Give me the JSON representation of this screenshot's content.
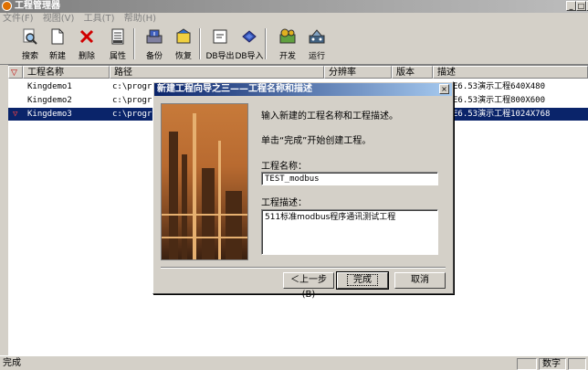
{
  "window": {
    "title": "工程管理器",
    "menu": [
      "文件(F)",
      "视图(V)",
      "工具(T)",
      "帮助(H)"
    ]
  },
  "toolbar": {
    "items": [
      {
        "label": "搜索",
        "icon": "search-icon"
      },
      {
        "label": "新建",
        "icon": "new-document-icon"
      },
      {
        "label": "删除",
        "icon": "delete-x-icon"
      },
      {
        "label": "属性",
        "icon": "properties-icon"
      },
      {
        "label": "备份",
        "icon": "backup-icon"
      },
      {
        "label": "恢复",
        "icon": "restore-icon"
      },
      {
        "label": "DB导出",
        "icon": "db-export-icon"
      },
      {
        "label": "DB导入",
        "icon": "db-import-icon"
      },
      {
        "label": "开发",
        "icon": "develop-icon"
      },
      {
        "label": "运行",
        "icon": "run-icon"
      }
    ]
  },
  "list": {
    "headers": {
      "name": "工程名称",
      "path": "路径",
      "resolution": "分辨率",
      "version": "版本",
      "desc": "描述"
    },
    "rows": [
      {
        "name": "Kingdemo1",
        "path": "c:\\program",
        "desc": "E6.53演示工程640X480",
        "selected": false
      },
      {
        "name": "Kingdemo2",
        "path": "c:\\program",
        "desc": "E6.53演示工程800X600",
        "selected": false
      },
      {
        "name": "Kingdemo3",
        "path": "c:\\program",
        "desc": "E6.53演示工程1024X768",
        "selected": true
      }
    ]
  },
  "status": {
    "text": "完成",
    "indicator": "数字"
  },
  "dialog": {
    "title": "新建工程向导之三——工程名称和描述",
    "intro": "输入新建的工程名称和工程描述。",
    "hint": "单击“完成”开始创建工程。",
    "name_label": "工程名称：",
    "name_value": "TEST_modbus",
    "desc_label": "工程描述：",
    "desc_value": "511标准modbus程序通讯测试工程",
    "back_button": "＜上一步(B)",
    "finish_button": "完成",
    "cancel_button": "取消",
    "close_glyph": "×"
  },
  "colors": {
    "selection": "#0a246a",
    "face": "#d4d0c8",
    "flag": "#c00000"
  }
}
